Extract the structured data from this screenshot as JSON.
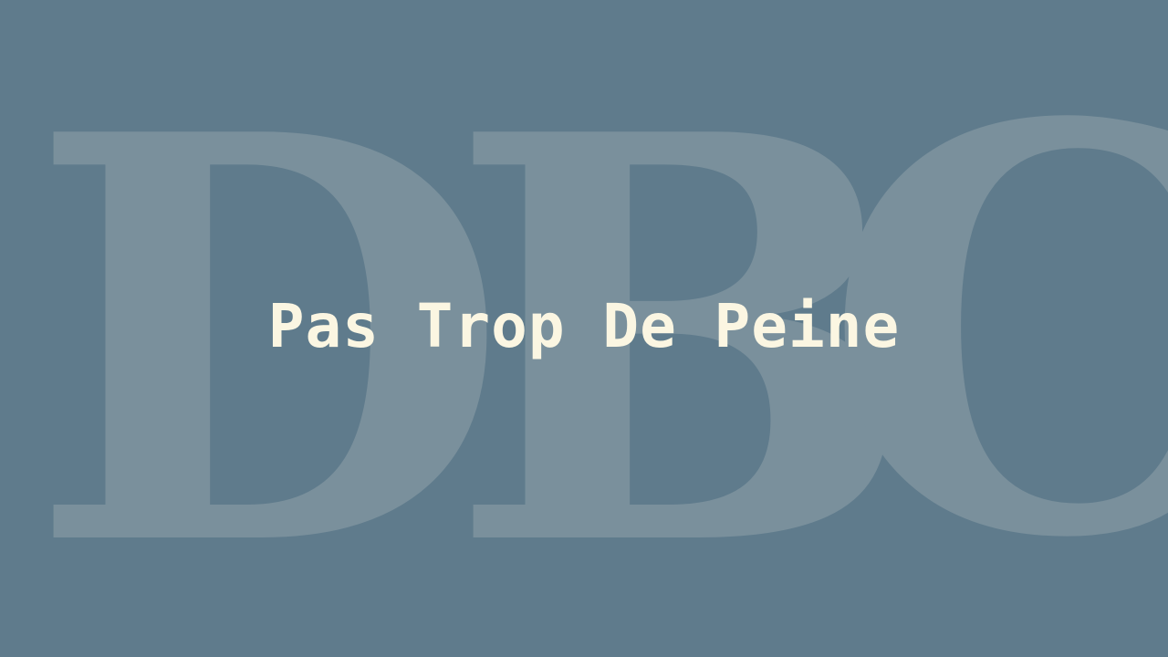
{
  "background_color": "#5f7b8c",
  "watermark": {
    "letters": [
      "D",
      "B",
      "C"
    ],
    "color": "#7a909c"
  },
  "title": {
    "text": "Pas Trop De Peine",
    "color": "#fbf6e2"
  }
}
